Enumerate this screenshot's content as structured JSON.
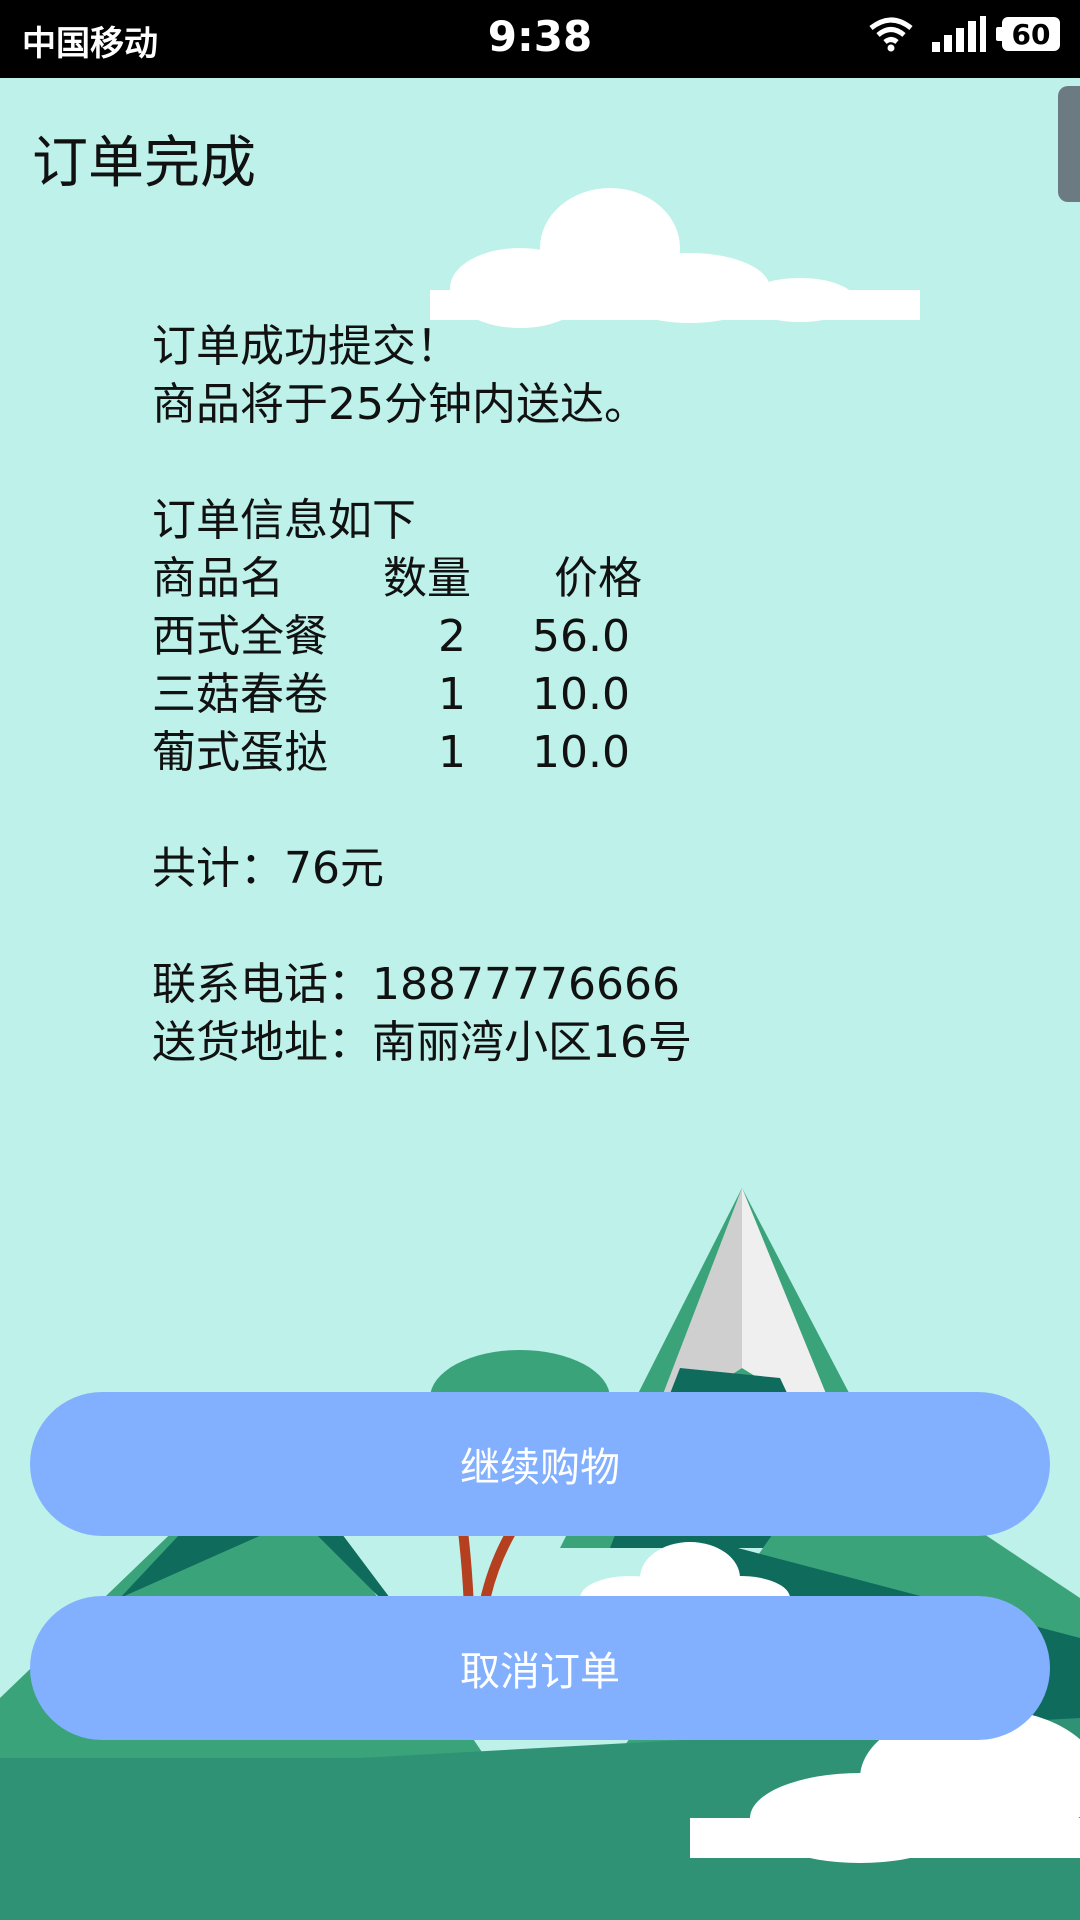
{
  "status_bar": {
    "carrier": "中国移动",
    "time": "9:38",
    "battery": "60"
  },
  "page": {
    "title": "订单完成"
  },
  "order": {
    "success_line": "订单成功提交！",
    "delivery_line": "商品将于25分钟内送达。",
    "info_heading": "订单信息如下",
    "table_headers": {
      "name": "商品名",
      "qty": "数量",
      "price": "价格"
    },
    "items": [
      {
        "name": "西式全餐",
        "qty": "2",
        "price": "56.0"
      },
      {
        "name": "三菇春卷",
        "qty": "1",
        "price": "10.0"
      },
      {
        "name": "葡式蛋挞",
        "qty": "1",
        "price": "10.0"
      }
    ],
    "total": "共计：76元",
    "phone": "联系电话：18877776666",
    "address": "送货地址：南丽湾小区16号"
  },
  "buttons": {
    "continue": "继续购物",
    "cancel": "取消订单"
  },
  "colors": {
    "background": "#bdf1ea",
    "button": "#82b0ff",
    "mountain_dark": "#0f6c5d",
    "mountain_mid": "#3aa37a",
    "snow": "#eeeeee"
  }
}
